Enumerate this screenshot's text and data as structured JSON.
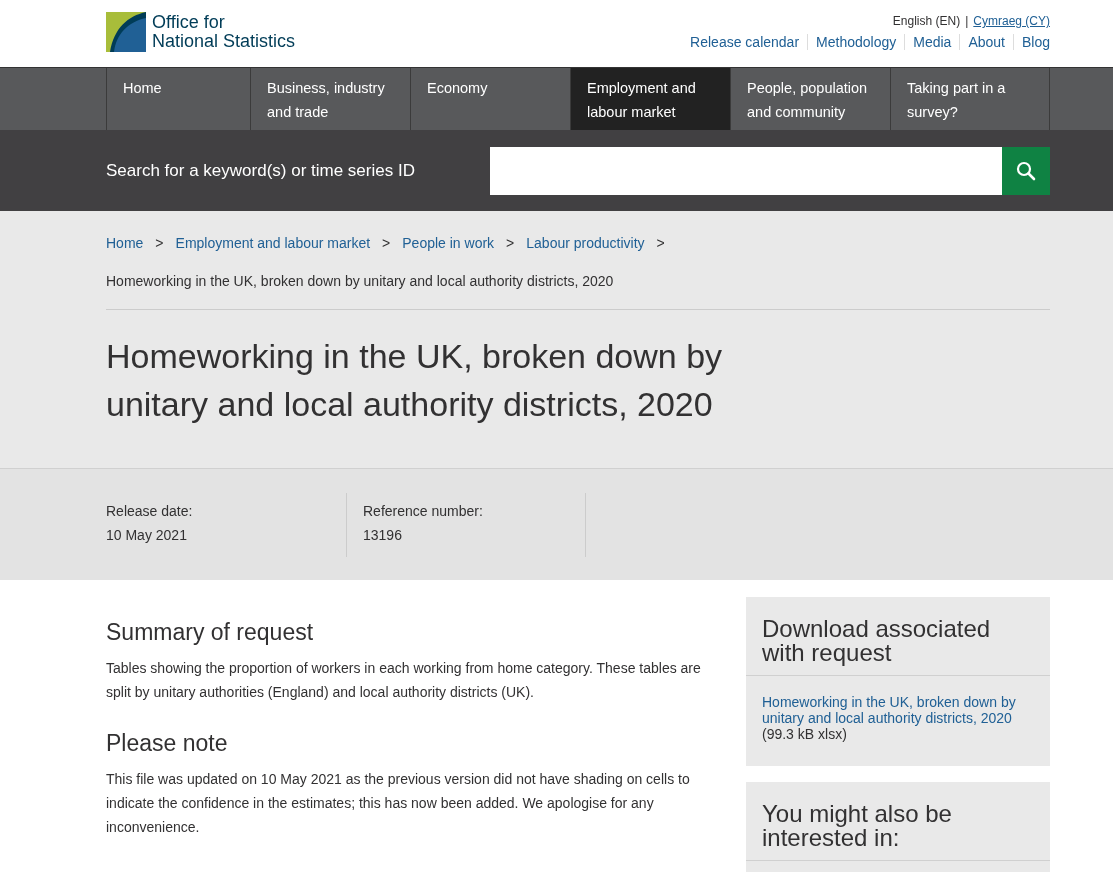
{
  "header": {
    "logo_line1": "Office for",
    "logo_line2": "National Statistics",
    "language": {
      "current": "English (EN)",
      "separator": "|",
      "other": "Cymraeg (CY)"
    },
    "links": [
      "Release calendar",
      "Methodology",
      "Media",
      "About",
      "Blog"
    ]
  },
  "nav": [
    {
      "label": "Home",
      "selected": false
    },
    {
      "label": "Business, industry and trade",
      "selected": false
    },
    {
      "label": "Economy",
      "selected": false
    },
    {
      "label": "Employment and labour market",
      "selected": true
    },
    {
      "label": "People, population and community",
      "selected": false
    },
    {
      "label": "Taking part in a survey?",
      "selected": false
    }
  ],
  "search": {
    "label": "Search for a keyword(s) or time series ID"
  },
  "breadcrumbs": [
    "Home",
    "Employment and labour market",
    "People in work",
    "Labour productivity"
  ],
  "breadcrumb_separator": ">",
  "breadcrumb_current": "Homeworking in the UK, broken down by unitary and local authority districts, 2020",
  "title": "Homeworking in the UK, broken down by unitary and local authority districts, 2020",
  "meta": [
    {
      "label": "Release date:",
      "value": "10 May 2021"
    },
    {
      "label": "Reference number:",
      "value": "13196"
    }
  ],
  "sections": [
    {
      "heading": "Summary of request",
      "text": "Tables showing the proportion of workers in each working from home category. These tables are split by unitary authorities (England) and local authority districts (UK)."
    },
    {
      "heading": "Please note",
      "text": "This file was updated on 10 May 2021 as the previous version did not have shading on cells to indicate the confidence in the estimates; this has now been added. We apologise for any inconvenience."
    }
  ],
  "sidebar": [
    {
      "heading": "Download associated with request",
      "link": "Homeworking in the UK, broken down by unitary and local authority districts, 2020",
      "meta": "(99.3 kB xlsx)"
    },
    {
      "heading": "You might also be interested in:"
    }
  ]
}
